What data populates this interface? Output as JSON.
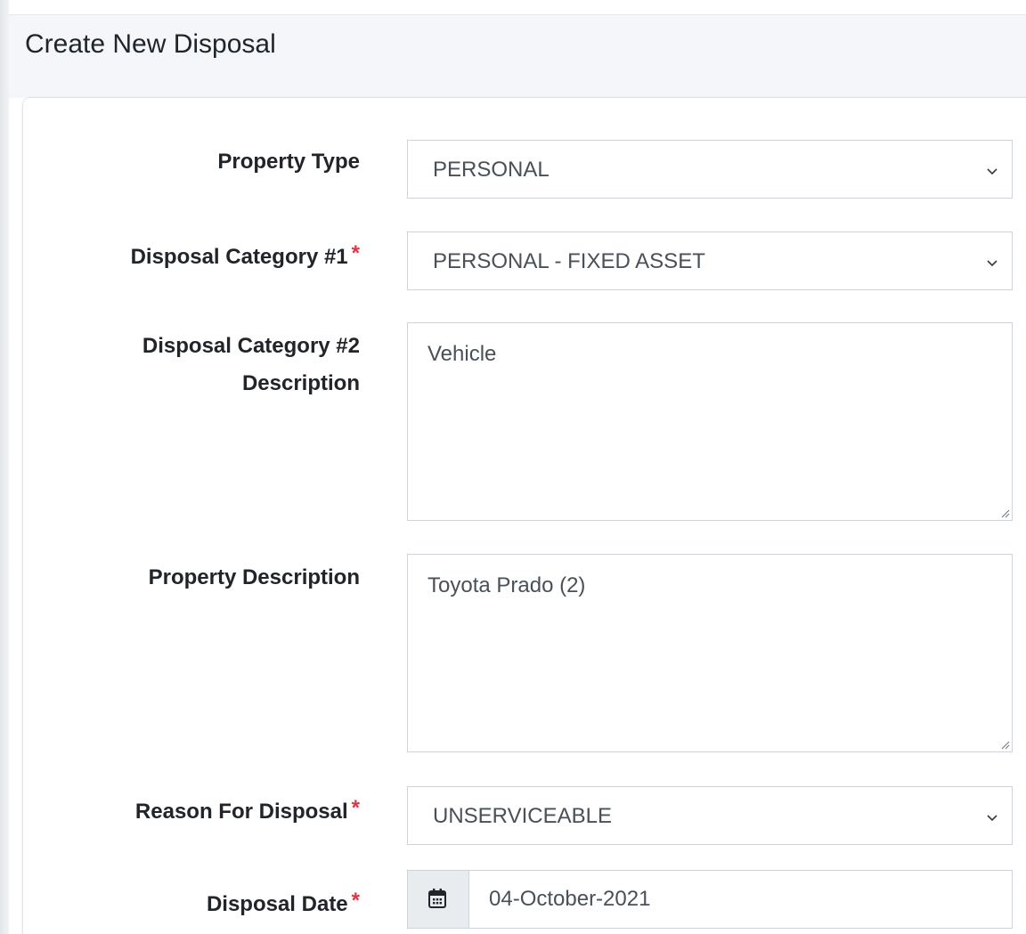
{
  "header": {
    "title": "Create New Disposal"
  },
  "form": {
    "property_type": {
      "label": "Property Type",
      "value": "PERSONAL"
    },
    "disposal_category_1": {
      "label": "Disposal Category #1",
      "required_mark": "*",
      "value": "PERSONAL - FIXED ASSET"
    },
    "disposal_category_2": {
      "label_line1": "Disposal Category #2",
      "label_line2": "Description",
      "value": "Vehicle"
    },
    "property_description": {
      "label": "Property Description",
      "value": "Toyota Prado (2)"
    },
    "reason_for_disposal": {
      "label": "Reason For Disposal",
      "required_mark": "*",
      "value": "UNSERVICEABLE"
    },
    "disposal_date": {
      "label": "Disposal Date",
      "required_mark": "*",
      "value": "04-October-2021",
      "icon": "calendar-icon"
    }
  },
  "colors": {
    "required": "#dc3545",
    "border": "#ced4da",
    "header_bg": "#f4f6f9",
    "addon_bg": "#e9ecef"
  }
}
